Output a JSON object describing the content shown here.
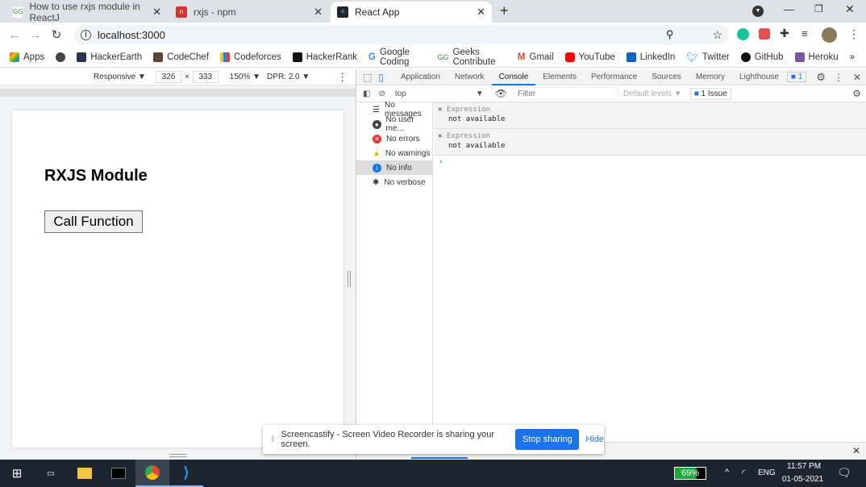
{
  "tabs": [
    {
      "label": "How to use rxjs module in ReactJ",
      "favicon": "GG"
    },
    {
      "label": "rxjs - npm",
      "favicon": "n"
    },
    {
      "label": "React App",
      "favicon": "react"
    }
  ],
  "address": {
    "url": "localhost:3000"
  },
  "bookmarks": [
    "Apps",
    "HackerEarth",
    "CodeChef",
    "Codeforces",
    "HackerRank",
    "Google Coding",
    "Geeks Contribute",
    "Gmail",
    "YouTube",
    "LinkedIn",
    "Twitter",
    "GitHub",
    "Heroku"
  ],
  "device_toolbar": {
    "mode": "Responsive ▼",
    "width": "326",
    "x": "×",
    "height": "333",
    "zoom": "150% ▼",
    "dpr": "DPR: 2.0 ▼"
  },
  "page": {
    "heading": "RXJS Module",
    "button": "Call Function"
  },
  "devtools": {
    "tabs": [
      "Application",
      "Network",
      "Console",
      "Elements",
      "Performance",
      "Sources",
      "Memory",
      "Lighthouse"
    ],
    "issues_badge": "1",
    "context": "top",
    "filter_placeholder": "Filter",
    "levels": "Default levels ▼",
    "issue_btn": "1 Issue",
    "sidebar": [
      "No messages",
      "No user me...",
      "No errors",
      "No warnings",
      "No info",
      "No verbose"
    ],
    "expressions": [
      {
        "label": "Expression",
        "value": "not available"
      },
      {
        "label": "Expression",
        "value": "not available"
      }
    ],
    "prompt": "›"
  },
  "banner": {
    "text": "Screencastify - Screen Video Recorder is sharing your screen.",
    "stop": "Stop sharing",
    "hide": "Hide"
  },
  "taskbar": {
    "battery": "69%",
    "lang": "ENG",
    "time": "11:57 PM",
    "date": "01-05-2021"
  }
}
